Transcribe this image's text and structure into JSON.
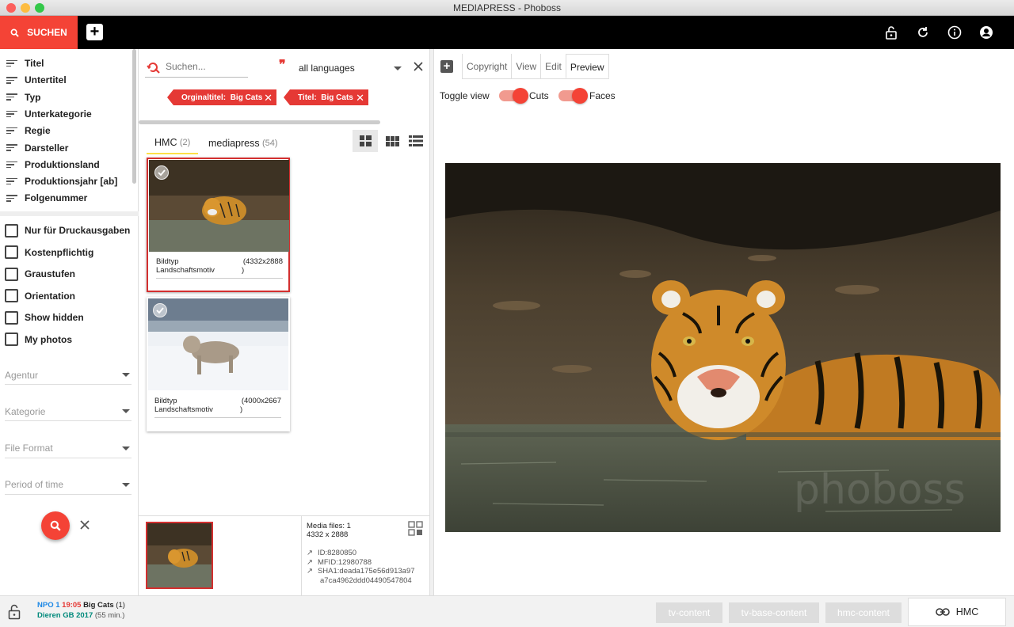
{
  "window": {
    "title": "MEDIAPRESS - Phoboss"
  },
  "topbar": {
    "search_label": "SUCHEN",
    "add_label": "+"
  },
  "left": {
    "filters": [
      "Titel",
      "Untertitel",
      "Typ",
      "Unterkategorie",
      "Regie",
      "Darsteller",
      "Produktionsland",
      "Produktionsjahr [ab]",
      "Folgenummer"
    ],
    "checkboxes": [
      "Nur für Druckausgaben",
      "Kostenpflichtig",
      "Graustufen",
      "Orientation",
      "Show hidden",
      "My photos"
    ],
    "dropdowns": [
      "Agentur",
      "Kategorie",
      "File Format",
      "Period of time"
    ]
  },
  "search": {
    "placeholder": "Suchen...",
    "language": "all languages",
    "chips": [
      {
        "key": "Orginaltitel:",
        "value": "Big Cats"
      },
      {
        "key": "Titel:",
        "value": "Big Cats"
      }
    ],
    "tabs": [
      {
        "label": "HMC",
        "count": "(2)"
      },
      {
        "label": "mediapress",
        "count": "(54)"
      }
    ]
  },
  "results": [
    {
      "type_label": "Bildtyp",
      "subtype": "Landschaftsmotiv",
      "dims": "(4332x2888",
      "dims2": ")"
    },
    {
      "type_label": "Bildtyp",
      "subtype": "Landschaftsmotiv",
      "dims": "(4000x2667",
      "dims2": ")"
    }
  ],
  "details": {
    "media_files": "Media files: 1",
    "dimensions": "4332 x 2888",
    "id": "ID:8280850",
    "mfid": "MFID:12980788",
    "sha1_a": "SHA1:deada175e56d913a97",
    "sha1_b": "a7ca4962ddd04490547804"
  },
  "preview": {
    "tabs": [
      "Copyright",
      "View",
      "Edit",
      "Preview"
    ],
    "toggle_view": "Toggle view",
    "cuts": "Cuts",
    "faces": "Faces",
    "watermark": "phoboss"
  },
  "bottom": {
    "channel": "NPO 1",
    "time": "19:05",
    "title": "Big Cats",
    "count": "(1)",
    "show": "Dieren GB 2017",
    "duration": "(55 min.)",
    "buttons": [
      "tv-content",
      "tv-base-content",
      "hmc-content"
    ],
    "hmc_button": "HMC"
  },
  "colors": {
    "accent": "#f44336",
    "topbar": "#000000",
    "selected_border": "#d32f2f"
  }
}
